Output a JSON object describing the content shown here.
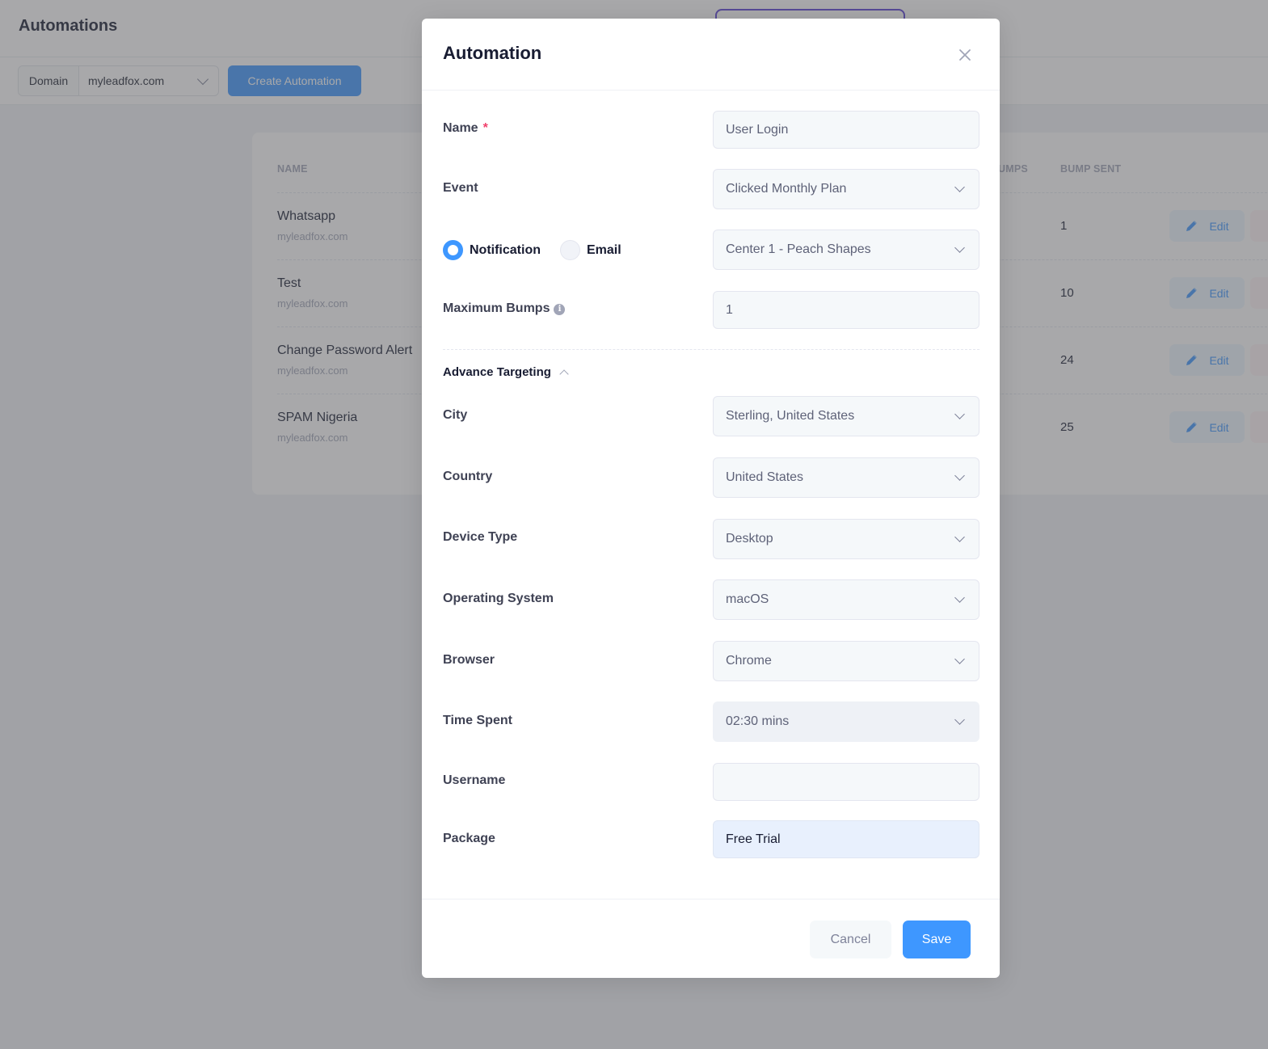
{
  "page": {
    "title": "Automations",
    "domain_label": "Domain",
    "domain_value": "myleadfox.com",
    "create_button": "Create Automation"
  },
  "table": {
    "headers": {
      "name": "NAME",
      "max_bumps": "UMPS",
      "bump_sent": "BUMP SENT"
    },
    "rows": [
      {
        "name": "Whatsapp",
        "domain": "myleadfox.com",
        "bump_sent": "1",
        "edit": "Edit"
      },
      {
        "name": "Test",
        "domain": "myleadfox.com",
        "bump_sent": "10",
        "edit": "Edit"
      },
      {
        "name": "Change Password Alert",
        "domain": "myleadfox.com",
        "bump_sent": "24",
        "edit": "Edit"
      },
      {
        "name": "SPAM Nigeria",
        "domain": "myleadfox.com",
        "bump_sent": "25",
        "edit": "Edit"
      }
    ]
  },
  "modal": {
    "title": "Automation",
    "fields": {
      "name": {
        "label": "Name",
        "required_mark": "*",
        "value": "User Login"
      },
      "event": {
        "label": "Event",
        "value": "Clicked Monthly Plan"
      },
      "channel": {
        "options": [
          "Notification",
          "Email"
        ],
        "selected": "Notification",
        "template_value": "Center 1 - Peach Shapes"
      },
      "max_bumps": {
        "label": "Maximum Bumps",
        "info_icon": "i",
        "value": "1"
      }
    },
    "advance_targeting": {
      "label": "Advance Targeting",
      "expanded": true,
      "city": {
        "label": "City",
        "value": "Sterling, United States"
      },
      "country": {
        "label": "Country",
        "value": "United States"
      },
      "device_type": {
        "label": "Device Type",
        "value": "Desktop"
      },
      "os": {
        "label": "Operating System",
        "value": "macOS"
      },
      "browser": {
        "label": "Browser",
        "value": "Chrome"
      },
      "time_spent": {
        "label": "Time Spent",
        "value": "02:30 mins"
      },
      "username": {
        "label": "Username",
        "value": ""
      },
      "package": {
        "label": "Package",
        "value": "Free Trial"
      }
    },
    "footer": {
      "cancel": "Cancel",
      "save": "Save"
    }
  },
  "colors": {
    "primary": "#3e97ff",
    "required": "#f1416c",
    "overlay_accent": "#5b3fd6"
  }
}
